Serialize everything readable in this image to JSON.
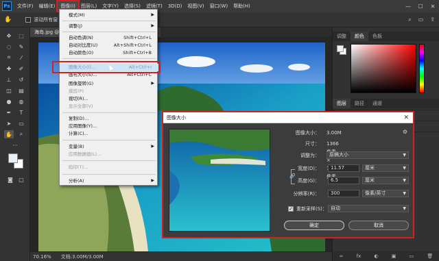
{
  "menubar": {
    "logo": "Ps",
    "items": [
      "文件(F)",
      "编辑(E)",
      "图像(I)",
      "图层(L)",
      "文字(Y)",
      "选择(S)",
      "滤镜(T)",
      "3D(D)",
      "视图(V)",
      "窗口(W)",
      "帮助(H)"
    ],
    "active_index": 2,
    "window_controls": [
      "—",
      "☐",
      "✕"
    ]
  },
  "options_bar": {
    "tool_icon": "hand-icon",
    "scroll_all_label": "滚动所有窗"
  },
  "document": {
    "tab_title": "海岛.jpg @",
    "zoom": "70.16%",
    "doc_info": "文档:3.00M/3.00M"
  },
  "image_menu": {
    "items": [
      {
        "label": "模式(M)",
        "shortcut": "",
        "submenu": true,
        "disabled": false
      },
      {
        "label": "调整(J)",
        "shortcut": "",
        "submenu": true,
        "disabled": false
      },
      {
        "label": "自动色调(N)",
        "shortcut": "Shift+Ctrl+L",
        "submenu": false,
        "disabled": false
      },
      {
        "label": "自动对比度(U)",
        "shortcut": "Alt+Shift+Ctrl+L",
        "submenu": false,
        "disabled": false
      },
      {
        "label": "自动颜色(O)",
        "shortcut": "Shift+Ctrl+B",
        "submenu": false,
        "disabled": false
      },
      {
        "label": "图像大小(I)...",
        "shortcut": "Alt+Ctrl+I",
        "submenu": false,
        "disabled": false,
        "highlighted": true
      },
      {
        "label": "画布大小(S)...",
        "shortcut": "Alt+Ctrl+C",
        "submenu": false,
        "disabled": false
      },
      {
        "label": "图像旋转(G)",
        "shortcut": "",
        "submenu": true,
        "disabled": false
      },
      {
        "label": "裁剪(P)",
        "shortcut": "",
        "submenu": false,
        "disabled": true
      },
      {
        "label": "裁切(R)...",
        "shortcut": "",
        "submenu": false,
        "disabled": false
      },
      {
        "label": "显示全部(V)",
        "shortcut": "",
        "submenu": false,
        "disabled": true
      },
      {
        "label": "复制(D)...",
        "shortcut": "",
        "submenu": false,
        "disabled": false
      },
      {
        "label": "应用图像(Y)...",
        "shortcut": "",
        "submenu": false,
        "disabled": false
      },
      {
        "label": "计算(C)...",
        "shortcut": "",
        "submenu": false,
        "disabled": false
      },
      {
        "label": "变量(B)",
        "shortcut": "",
        "submenu": true,
        "disabled": false
      },
      {
        "label": "应用数据组(L)...",
        "shortcut": "",
        "submenu": false,
        "disabled": true
      },
      {
        "label": "陷印(T)...",
        "shortcut": "",
        "submenu": false,
        "disabled": true
      },
      {
        "label": "分析(A)",
        "shortcut": "",
        "submenu": true,
        "disabled": false
      }
    ]
  },
  "right_panel": {
    "top_tabs": [
      "调整",
      "颜色",
      "色板"
    ],
    "active_top_tab": 1,
    "layer_tabs": [
      "图层",
      "路径",
      "通道"
    ],
    "bottom_icons": [
      "∞",
      "fx",
      "◐",
      "▣",
      "▭",
      "🗑"
    ]
  },
  "image_size_dialog": {
    "title": "图像大小",
    "close": "✕",
    "image_size_label": "图像大小：",
    "image_size_value": "3.00M",
    "dimensions_label": "尺寸：",
    "dimensions_value": "1366 像素 × 768 像素",
    "fit_to_label": "调整为：",
    "fit_to_value": "原稿大小",
    "width_label": "宽度(D)：",
    "width_value": "11.57",
    "width_unit": "厘米",
    "height_label": "高度(G)：",
    "height_value": "6.5",
    "height_unit": "厘米",
    "resolution_label": "分辨率(R)：",
    "resolution_value": "300",
    "resolution_unit": "像素/英寸",
    "resample_label": "重新采样(S)：",
    "resample_checked": true,
    "resample_value": "自动",
    "ok_label": "确定",
    "cancel_label": "取消"
  }
}
